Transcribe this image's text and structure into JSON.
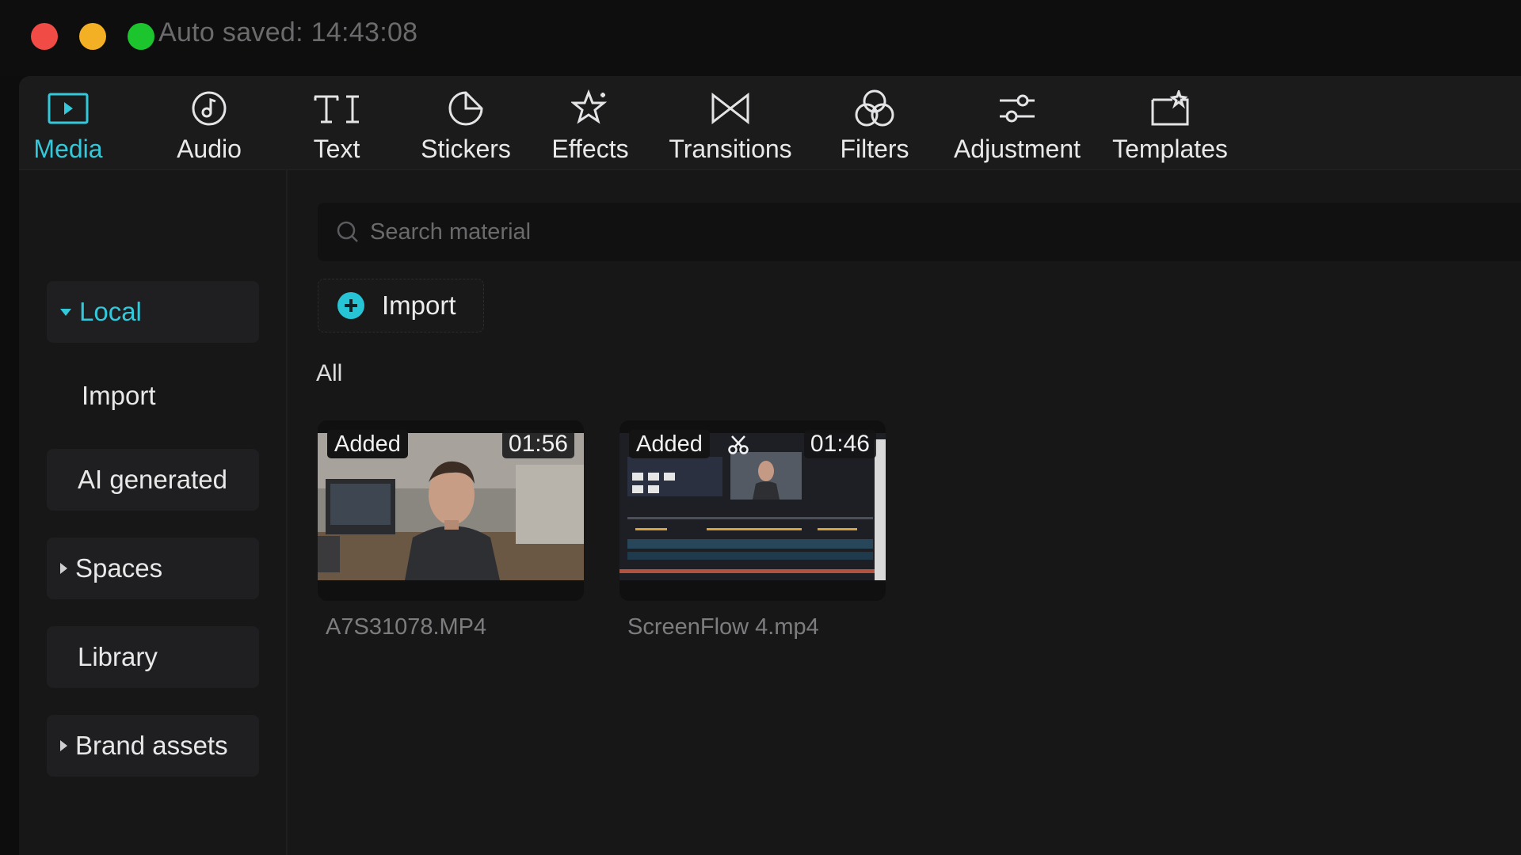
{
  "window": {
    "autosave_text": "Auto saved: 14:43:08"
  },
  "toolbar": {
    "items": [
      {
        "label": "Media",
        "icon": "media-icon",
        "active": true
      },
      {
        "label": "Audio",
        "icon": "audio-icon"
      },
      {
        "label": "Text",
        "icon": "text-icon"
      },
      {
        "label": "Stickers",
        "icon": "sticker-icon"
      },
      {
        "label": "Effects",
        "icon": "effects-icon"
      },
      {
        "label": "Transitions",
        "icon": "transitions-icon"
      },
      {
        "label": "Filters",
        "icon": "filters-icon"
      },
      {
        "label": "Adjustment",
        "icon": "adjustment-icon"
      },
      {
        "label": "Templates",
        "icon": "templates-icon"
      }
    ]
  },
  "sidebar": {
    "items": [
      {
        "label": "Local",
        "expanded": true,
        "active": true
      },
      {
        "label": "Import"
      },
      {
        "label": "AI generated"
      },
      {
        "label": "Spaces",
        "expanded": false
      },
      {
        "label": "Library"
      },
      {
        "label": "Brand assets",
        "expanded": false
      }
    ]
  },
  "main": {
    "search_placeholder": "Search material",
    "import_label": "Import",
    "section_label": "All",
    "media": [
      {
        "badge": "Added",
        "duration": "01:56",
        "filename": "A7S31078.MP4"
      },
      {
        "badge": "Added",
        "duration": "01:46",
        "filename": "ScreenFlow 4.mp4",
        "has_cut_icon": true
      }
    ]
  },
  "colors": {
    "accent": "#33c9da",
    "background": "#161617",
    "close": "#f04b45",
    "minimize": "#f4b024",
    "maximize": "#1cc42e"
  }
}
